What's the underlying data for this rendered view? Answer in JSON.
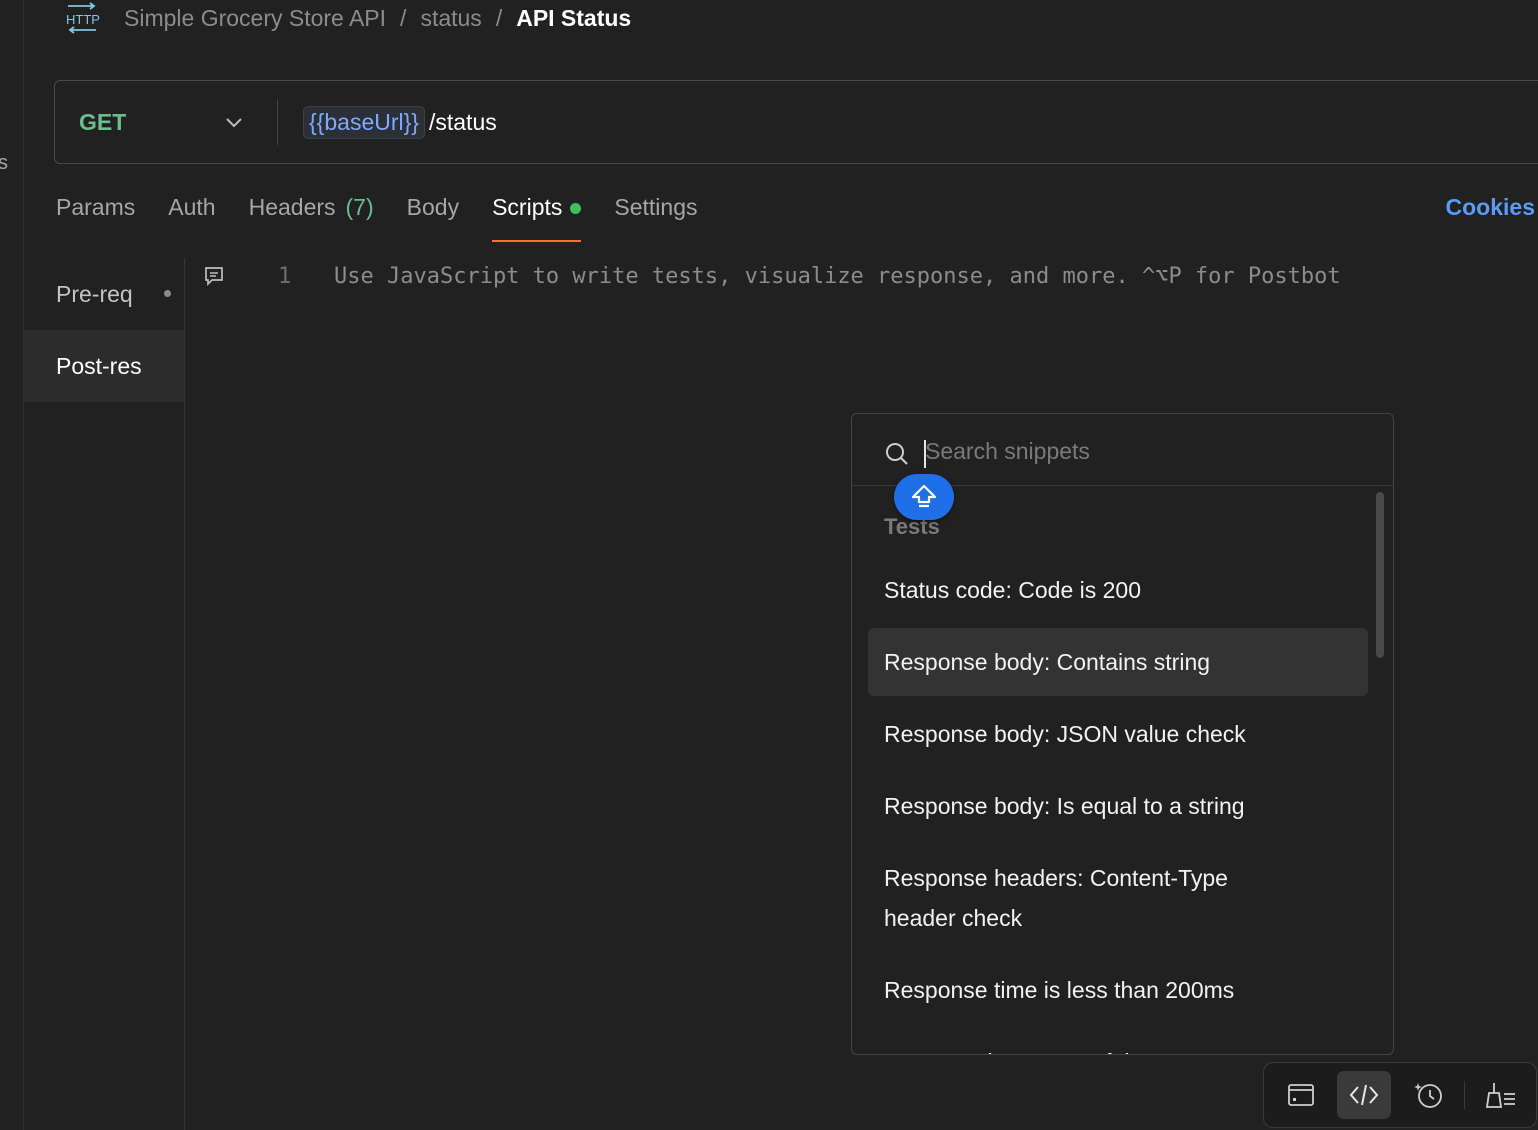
{
  "left_rail": {
    "clipped_text": "s"
  },
  "breadcrumb": {
    "icon": "http-icon",
    "icon_text": "HTTP",
    "collection": "Simple Grocery Store API",
    "folder": "status",
    "current": "API Status",
    "separator": "/"
  },
  "request": {
    "method": "GET",
    "url_variable": "{{baseUrl}}",
    "url_path": "/status"
  },
  "tabs": [
    {
      "label": "Params"
    },
    {
      "label": "Auth"
    },
    {
      "label": "Headers",
      "count": "(7)"
    },
    {
      "label": "Body"
    },
    {
      "label": "Scripts",
      "active": true
    },
    {
      "label": "Settings"
    }
  ],
  "cookies_label": "Cookies",
  "script_nav": [
    {
      "label": "Pre-req"
    },
    {
      "label": "Post-res",
      "active": true
    }
  ],
  "editor": {
    "line_number": "1",
    "placeholder": "Use JavaScript to write tests, visualize response, and more. ^⌥P for Postbot"
  },
  "snippets": {
    "search_placeholder": "Search snippets",
    "heading": "Tests",
    "items": [
      "Status code: Code is 200",
      "Response body: Contains string",
      "Response body: JSON value check",
      "Response body: Is equal to a string",
      "Response headers: Content-Type header check",
      "Response time is less than 200ms",
      "Status code: Successful POST request"
    ],
    "hovered_index": 1
  },
  "colors": {
    "accent": "#ff6c37",
    "method_get": "#6bbd8e",
    "link_blue": "#5b9bf8",
    "fab_blue": "#1f6fe8",
    "status_dot": "#3fbf5f"
  },
  "toolbar_icons": [
    "panel-icon",
    "code-icon",
    "postbot-icon",
    "cleanup-icon"
  ]
}
